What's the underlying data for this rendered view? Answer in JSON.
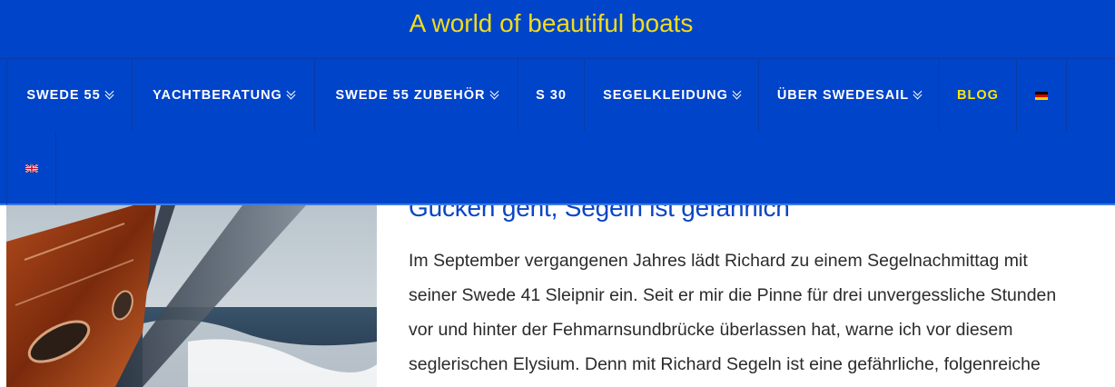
{
  "header": {
    "tagline": "A world of beautiful boats"
  },
  "nav": {
    "items": [
      {
        "label": "SWEDE 55",
        "dropdown": true
      },
      {
        "label": "YACHTBERATUNG",
        "dropdown": true
      },
      {
        "label": "SWEDE 55 ZUBEHÖR",
        "dropdown": true
      },
      {
        "label": "S 30",
        "dropdown": false
      },
      {
        "label": "SEGELKLEIDUNG",
        "dropdown": true
      },
      {
        "label": "ÜBER SWEDESAIL",
        "dropdown": true
      },
      {
        "label": "BLOG",
        "dropdown": false,
        "active": true
      }
    ],
    "languages": [
      {
        "code": "de",
        "icon": "flag-germany-icon"
      },
      {
        "code": "en",
        "icon": "flag-uk-icon"
      }
    ]
  },
  "post": {
    "title": "Gucken geht, Segeln ist gefährlich",
    "excerpt_lines": [
      "Im September vergangenen Jahres lädt Richard zu einem Segelnachmittag mit",
      "seiner Swede 41 Sleipnir ein. Seit er mir die Pinne für drei unvergessliche Stunden",
      "vor und hinter der Fehmarnsundbrücke überlassen hat, warne ich vor diesem",
      "seglerischen Elysium. Denn mit Richard Segeln ist eine gefährliche, folgenreiche"
    ]
  },
  "colors": {
    "header_bg": "#0044c9",
    "accent_yellow": "#ffe600",
    "title_blue": "#0a45c5"
  }
}
